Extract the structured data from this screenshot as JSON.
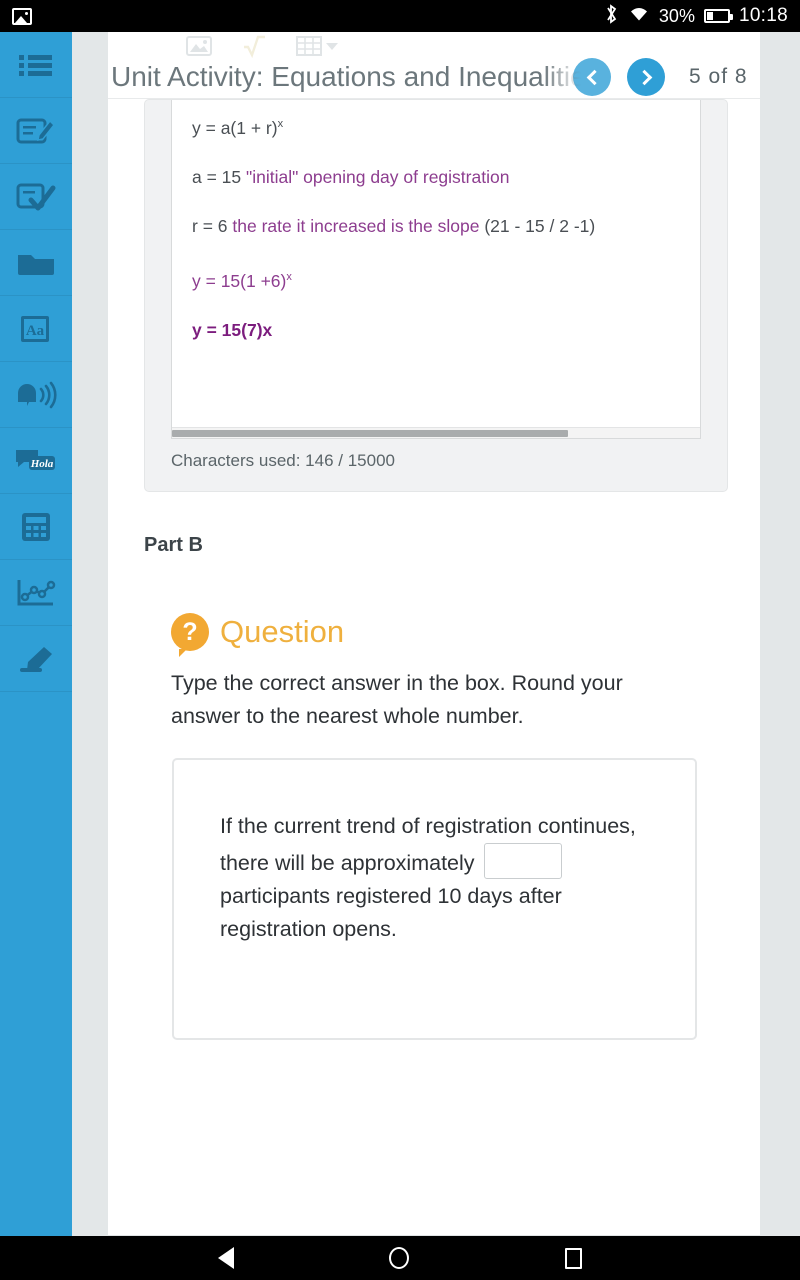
{
  "statusbar": {
    "app_icon": "image-icon",
    "bluetooth_icon": "bluetooth-icon",
    "wifi_icon": "wifi-icon",
    "battery_percent": "30%",
    "time": "10:18"
  },
  "sidebar": {
    "items": [
      {
        "name": "sidebar-item-list",
        "icon": "list-icon"
      },
      {
        "name": "sidebar-item-notes",
        "icon": "notepad-pencil-icon"
      },
      {
        "name": "sidebar-item-assignments",
        "icon": "checklist-icon"
      },
      {
        "name": "sidebar-item-files",
        "icon": "folder-icon"
      },
      {
        "name": "sidebar-item-dictionary",
        "icon": "dictionary-aa-icon",
        "label": "Aa"
      },
      {
        "name": "sidebar-item-read-aloud",
        "icon": "text-to-speech-icon"
      },
      {
        "name": "sidebar-item-translate",
        "icon": "translate-hola-icon",
        "label": "Hola"
      },
      {
        "name": "sidebar-item-calculator",
        "icon": "calculator-icon"
      },
      {
        "name": "sidebar-item-graph",
        "icon": "line-graph-icon"
      },
      {
        "name": "sidebar-item-highlighter",
        "icon": "highlighter-icon"
      }
    ]
  },
  "header": {
    "title": "Unit Activity: Equations and Inequalities",
    "prev_label": "chevron-left-icon",
    "next_label": "chevron-right-icon",
    "pager": "5  of  8",
    "toolbar_icons": [
      "image-insert-icon",
      "square-root-icon",
      "table-insert-icon",
      "chevron-down-icon"
    ]
  },
  "editor": {
    "lines": [
      {
        "segments": [
          {
            "text": "y = a(1 + r)",
            "style": "plain"
          },
          {
            "text": "x",
            "style": "sup"
          }
        ]
      },
      {
        "segments": [
          {
            "text": "a = 15 ",
            "style": "plain"
          },
          {
            "text": "\"initial\" opening day of registration",
            "style": "purple"
          }
        ]
      },
      {
        "segments": [
          {
            "text": "r = 6 ",
            "style": "plain"
          },
          {
            "text": "the rate it increased is the slope",
            "style": "purple"
          },
          {
            "text": " (21 - 15 / 2 -1)",
            "style": "plain"
          }
        ]
      },
      {
        "segments": [
          {
            "text": "y = 15(1 +6)",
            "style": "purple"
          },
          {
            "text": "x",
            "style": "sup-purple"
          }
        ]
      },
      {
        "segments": [
          {
            "text": "y = 15(7)x",
            "style": "purple-bold"
          }
        ]
      }
    ],
    "line1": "y = a(1 + r)",
    "line1_sup": "x",
    "line2_black": "a = 15 ",
    "line2_purple": "\"initial\" opening day of registration",
    "line3_black": "r = 6 ",
    "line3_purple": "the rate it increased is the slope",
    "line3_tail": " (21 - 15 / 2 -1)",
    "line4": "y = 15(1 +6)",
    "line4_sup": "x",
    "line5": "y = 15(7)x",
    "character_count": "Characters used: 146 / 15000"
  },
  "part_b": {
    "label": "Part B",
    "question_heading": "Question",
    "question_icon": "question-bubble-icon",
    "prompt": "Type the correct answer in the box. Round your answer to the nearest whole number.",
    "answer": {
      "text_before": "If the current trend of registration continues, there will be approximately",
      "input_value": "",
      "input_placeholder": "",
      "text_after": "participants registered 10 days after registration opens."
    }
  },
  "navbar": {
    "back": "back-triangle-icon",
    "home": "home-circle-icon",
    "recents": "recents-square-icon"
  },
  "colors": {
    "rail_blue": "#2f9fd6",
    "accent_orange": "#efb03e",
    "purple": "#8d3d8f",
    "purple_bold": "#7c1d7e",
    "page_gray": "#e3e7e8"
  }
}
